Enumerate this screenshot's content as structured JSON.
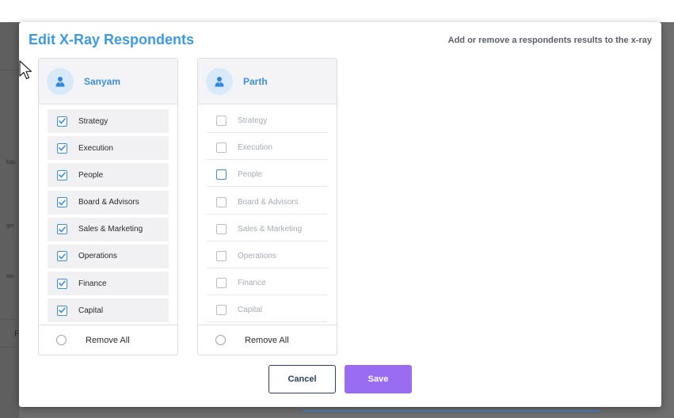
{
  "backdrop": {
    "fragments": [
      "futu",
      "gm",
      "om",
      "F"
    ]
  },
  "modal": {
    "title": "Edit X-Ray Respondents",
    "subtitle": "Add or remove a respondents results to the x-ray"
  },
  "respondents": [
    {
      "name": "Sanyam",
      "active": true,
      "items": [
        {
          "label": "Strategy",
          "checked": true
        },
        {
          "label": "Execution",
          "checked": true
        },
        {
          "label": "People",
          "checked": true
        },
        {
          "label": "Board & Advisors",
          "checked": true
        },
        {
          "label": "Sales & Marketing",
          "checked": true
        },
        {
          "label": "Operations",
          "checked": true
        },
        {
          "label": "Finance",
          "checked": true
        },
        {
          "label": "Capital",
          "checked": true
        }
      ],
      "remove_all_label": "Remove All"
    },
    {
      "name": "Parth",
      "active": false,
      "items": [
        {
          "label": "Strategy",
          "checked": false
        },
        {
          "label": "Execution",
          "checked": false
        },
        {
          "label": "People",
          "checked": false
        },
        {
          "label": "Board & Advisors",
          "checked": false
        },
        {
          "label": "Sales & Marketing",
          "checked": false
        },
        {
          "label": "Operations",
          "checked": false
        },
        {
          "label": "Finance",
          "checked": false
        },
        {
          "label": "Capital",
          "checked": false
        }
      ],
      "remove_all_label": "Remove All"
    }
  ],
  "buttons": {
    "cancel_label": "Cancel",
    "save_label": "Save"
  },
  "colors": {
    "accent": "#3a8fe0",
    "title": "#3b9be8",
    "save": "#9a6cf2"
  },
  "icons": {
    "avatar": "user-avatar-icon",
    "checkbox": "checkmark-icon",
    "cursor": "mouse-pointer-icon"
  }
}
